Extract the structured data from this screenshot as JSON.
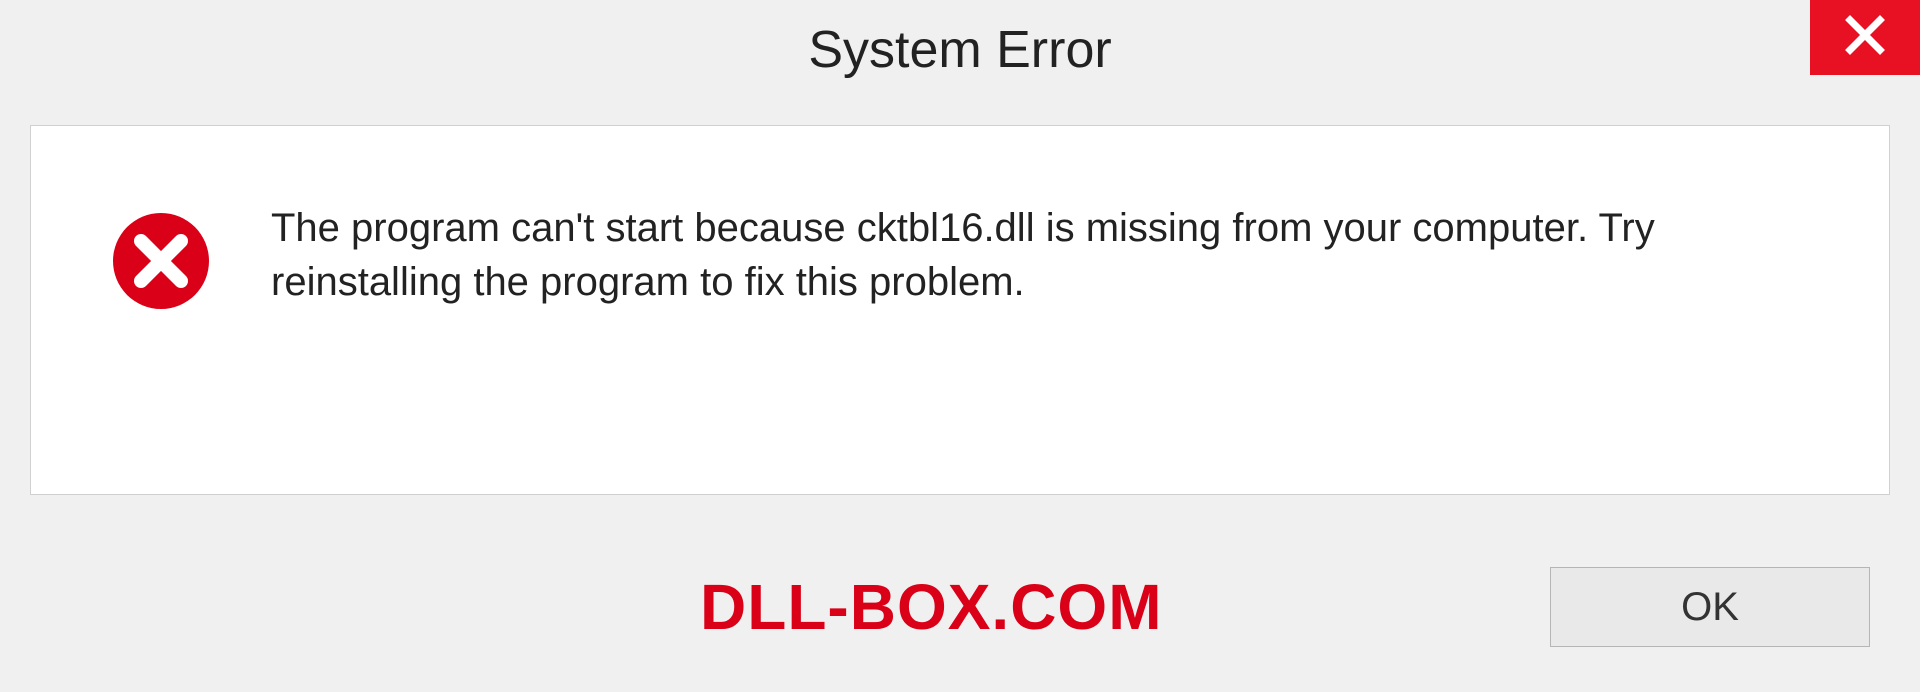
{
  "titlebar": {
    "title": "System Error"
  },
  "message": {
    "text": "The program can't start because cktbl16.dll is missing from your computer. Try reinstalling the program to fix this problem."
  },
  "footer": {
    "watermark": "DLL-BOX.COM",
    "ok_label": "OK"
  },
  "colors": {
    "close_bg": "#e81123",
    "error_icon": "#d90018",
    "watermark": "#d90018"
  }
}
